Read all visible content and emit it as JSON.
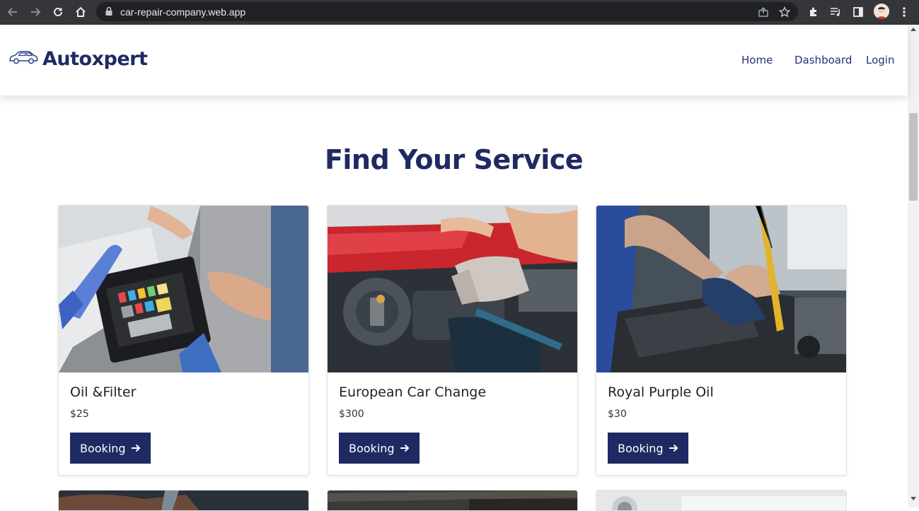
{
  "browser": {
    "url": "car-repair-company.web.app"
  },
  "site": {
    "brand": "Autoxpert",
    "nav": [
      {
        "label": "Home"
      },
      {
        "label": "Dashboard"
      },
      {
        "label": "Login"
      }
    ]
  },
  "services": {
    "title": "Find Your Service",
    "cards": [
      {
        "title": "Oil &Filter",
        "price": "$25",
        "button": "Booking",
        "image": "engine-fuse-box-photo"
      },
      {
        "title": "European Car Change",
        "price": "$300",
        "button": "Booking",
        "image": "mechanic-gloves-engine-photo"
      },
      {
        "title": "Royal Purple Oil",
        "price": "$30",
        "button": "Booking",
        "image": "mechanic-oil-dipstick-photo"
      }
    ]
  },
  "colors": {
    "brand_navy": "#1f2a63",
    "link_blue": "#26307a",
    "chrome_bg": "#35363a"
  }
}
